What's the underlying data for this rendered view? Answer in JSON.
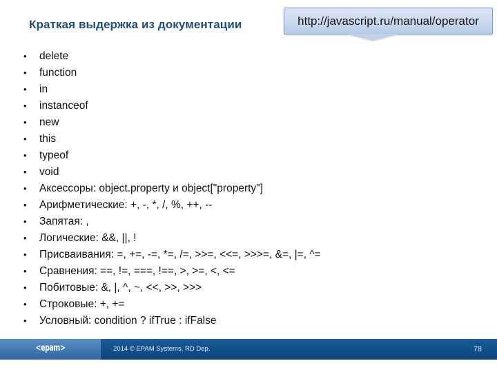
{
  "slide": {
    "title": "Краткая выдержка из документации",
    "callout": {
      "url": "http://javascript.ru/manual/operator"
    },
    "bullets": [
      "delete",
      "function",
      "in",
      "instanceof",
      "new",
      "this",
      "typeof",
      "void",
      "Аксессоры: object.property и object[\"property\"]",
      "Арифметические: +, -, *, /, %, ++, --",
      "Запятая: ,",
      "Логические: &&, ||, !",
      "Присваивания: =, +=, -=, *=, /=, >>=, <<=, >>>=, &=, |=, ^=",
      "Сравнения: ==, !=, ===, !==, >, >=, <, <=",
      "Побитовые: &, |, ^, ~, <<, >>, >>>",
      "Строковые: +, +=",
      "Условный: condition ? ifTrue : ifFalse"
    ],
    "bullet_glyph": "•",
    "footer": {
      "logo": "<epam>",
      "copyright": "2014 © EPAM Systems, RD Dep.",
      "slide_number": "78"
    },
    "colors": {
      "title": "#1f4e79",
      "callout_border": "#7b9ec9",
      "callout_fill": "#cfdcef",
      "footer_bar": "#14548f",
      "footer_left": "#497fb7"
    }
  }
}
